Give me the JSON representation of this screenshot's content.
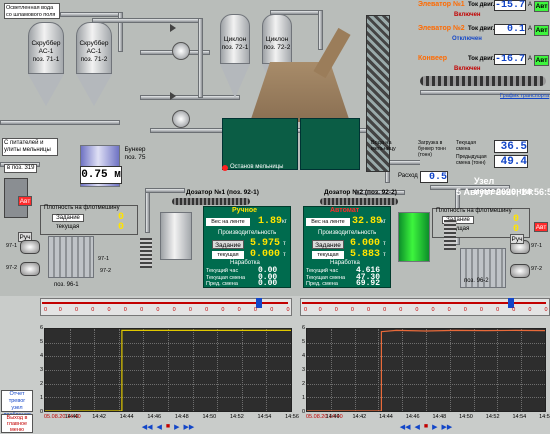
{
  "top_left_label": "Осветленная вода\nсо шламового поля",
  "scrubbers": [
    {
      "label": "Скруббер\nАС-1\nпоз. 71-1"
    },
    {
      "label": "Скруббер\nАС-1\nпоз. 71-2"
    }
  ],
  "cyclones": [
    {
      "label": "Циклон\nпоз. 72-1"
    },
    {
      "label": "Циклон\nпоз. 72-2"
    }
  ],
  "bunker": {
    "label": "Бункер\nпоз. 75",
    "level": "0.75 м"
  },
  "from_pitatel": "С питателей и\nулиты мельницы",
  "to_319": "в поз. 319",
  "stop_mill": "Останов мельницы",
  "water_to_mill": "Вода на\nмельницу",
  "elevators": [
    {
      "name": "Элеватор №1",
      "tok_label": "Ток двиг.",
      "value": "-15.7",
      "unit": "А",
      "state": "Включен",
      "auto": "Авт",
      "color": "#ff6a00"
    },
    {
      "name": "Элеватор №2",
      "tok_label": "Ток двиг.",
      "value": "0.1",
      "unit": "А",
      "state": "Отключен",
      "auto": "Авт",
      "color": "#ff6a00"
    },
    {
      "name": "Конвеер",
      "tok_label": "Ток двиг.",
      "value": "-16.7",
      "unit": "А",
      "state": "Включен",
      "auto": "Авт",
      "color": "#ff6a00"
    }
  ],
  "transport_chart": "График транспорта",
  "load_bunker": {
    "label1": "Загрузка в\nбункер тонн\n(тонн)",
    "value1": "36.5",
    "label1b": "Текущая\nсмена",
    "label2": "Предыдущая\nсмена (тонн)",
    "value2": "49.4",
    "rashod_label": "Расход",
    "rashod_value": "0.5"
  },
  "node": {
    "title": "Узел измельчения",
    "datetime": "5 Август 2020, 14:56:53"
  },
  "dozators": [
    {
      "label": "Дозатор №1 (поз. 92-1)",
      "mode": "Ручное",
      "mode_color": "#ffe400",
      "belt_label": "Вес на ленте",
      "belt_value": "1.89",
      "belt_unit": "кг",
      "prod_label": "Производительность",
      "zadanie_label": "Задание",
      "zadanie_value": "5.975",
      "zadanie_unit": "т",
      "tek_label": "текущая",
      "tek_value": "0.000",
      "tek_unit": "т",
      "nar_label": "Наработка",
      "hour_label": "Текущий час",
      "hour_value": "0.00",
      "shift_label": "Текущая смена",
      "shift_value": "0.00",
      "prev_label": "Пред. смена",
      "prev_value": "0.00",
      "unit": "т"
    },
    {
      "label": "Дозатор №2 (поз. 92-2)",
      "mode": "Автомат",
      "mode_color": "#ff2a2a",
      "belt_label": "Вес на ленте",
      "belt_value": "32.89",
      "belt_unit": "кг",
      "prod_label": "Производительность",
      "zadanie_label": "Задание",
      "zadanie_value": "6.000",
      "zadanie_unit": "т",
      "tek_label": "текущая",
      "tek_value": "5.883",
      "tek_unit": "т",
      "nar_label": "Наработка",
      "hour_label": "Текущий час",
      "hour_value": "4.616",
      "shift_label": "Текущая смена",
      "shift_value": "47.30",
      "prev_label": "Пред. смена",
      "prev_value": "69.92",
      "unit": "т"
    }
  ],
  "flotation": [
    {
      "title": "Плотность на флотмешину",
      "zadanie_label": "Задание",
      "zadanie_value": "0",
      "tek_label": "текущая",
      "tek_value": "0"
    },
    {
      "title": "Плотность на флотмешину",
      "zadanie_label": "Задание",
      "zadanie_value": "0",
      "tek_label": "текущая",
      "tek_value": "0"
    }
  ],
  "left_ctrl": {
    "auto": "Авт",
    "manual": "Руч",
    "v1": "97-1",
    "v2": "97-2",
    "p1": "поз. 96-1",
    "p1b": "97-1",
    "p2": "97-2"
  },
  "right_ctrl": {
    "auto": "Авт",
    "manual": "Руч",
    "p1": "поз. 96-2",
    "v1": "97-1",
    "v2": "97-2"
  },
  "trends": [
    {
      "y_ticks": [
        "6",
        "5",
        "4",
        "3",
        "2",
        "1",
        "0"
      ],
      "x_ticks": [
        "05.08.20 14:40",
        "14:40",
        "14:42",
        "14:44",
        "14:46",
        "14:48",
        "14:50",
        "14:52",
        "14:54",
        "14:56"
      ],
      "slider_ticks": [
        "0",
        "0",
        "0",
        "0",
        "0",
        "0",
        "0",
        "0",
        "0",
        "0",
        "0",
        "0",
        "0",
        "0",
        "0",
        "0"
      ]
    },
    {
      "y_ticks": [
        "6",
        "5",
        "4",
        "3",
        "2",
        "1",
        "0"
      ],
      "x_ticks": [
        "05.08.20 14:40",
        "14:40",
        "14:42",
        "14:44",
        "14:46",
        "14:48",
        "14:50",
        "14:52",
        "14:54",
        "14:56"
      ],
      "slider_ticks": [
        "0",
        "0",
        "0",
        "0",
        "0",
        "0",
        "0",
        "0",
        "0",
        "0",
        "0",
        "0",
        "0",
        "0",
        "0",
        "0"
      ]
    }
  ],
  "chart_data": [
    {
      "type": "line",
      "title": "",
      "xlabel": "",
      "ylabel": "",
      "ylim": [
        0,
        6
      ],
      "x": [
        "14:40",
        "14:42",
        "14:44",
        "14:45",
        "14:45",
        "14:46",
        "14:48",
        "14:50",
        "14:52",
        "14:54",
        "14:56"
      ],
      "series": [
        {
          "values": [
            0,
            0,
            0,
            0,
            5.9,
            5.9,
            5.9,
            5.9,
            5.9,
            5.9,
            5.9
          ],
          "color": "#e0c800"
        }
      ]
    },
    {
      "type": "line",
      "title": "",
      "xlabel": "",
      "ylabel": "",
      "ylim": [
        0,
        6
      ],
      "x": [
        "14:40",
        "14:42",
        "14:44",
        "14:45",
        "14:45",
        "14:46",
        "14:48",
        "14:50",
        "14:52",
        "14:54",
        "14:56"
      ],
      "series": [
        {
          "values": [
            0,
            0,
            0,
            0,
            5.8,
            5.9,
            5.85,
            5.9,
            5.88,
            5.9,
            5.88
          ],
          "color": "#e86a3a"
        }
      ]
    }
  ],
  "bottom_buttons": [
    {
      "label": "Отчет тревог\nузел\nдробления",
      "color": "#1346c8"
    },
    {
      "label": "Выход в\nглавное\nменю",
      "color": "#c20000"
    }
  ]
}
